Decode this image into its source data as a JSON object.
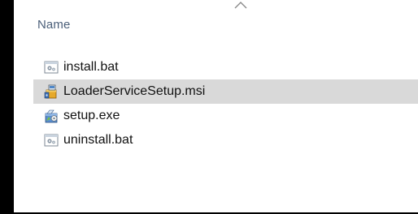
{
  "explorer": {
    "column_header": "Name",
    "sort_indicator_icon": "chevron-up-icon",
    "files": [
      {
        "name": "install.bat",
        "icon": "batch-file-icon",
        "selected": false
      },
      {
        "name": "LoaderServiceSetup.msi",
        "icon": "installer-package-icon",
        "selected": true
      },
      {
        "name": "setup.exe",
        "icon": "setup-exe-icon",
        "selected": false
      },
      {
        "name": "uninstall.bat",
        "icon": "batch-file-icon",
        "selected": false
      }
    ]
  },
  "colors": {
    "selection": "#d9d9d9",
    "header_text": "#4c607a",
    "file_text": "#111111"
  }
}
